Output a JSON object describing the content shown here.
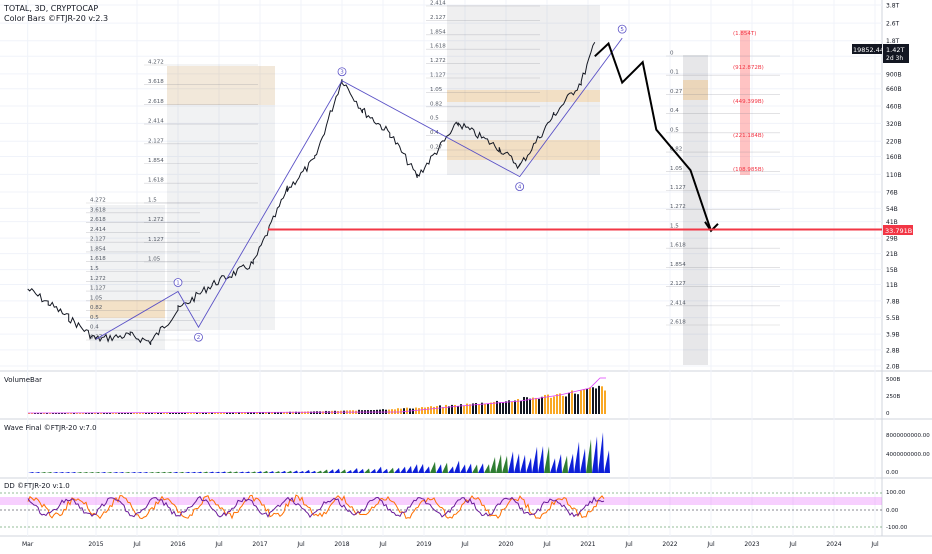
{
  "header": {
    "symbol_line": "TOTAL, 3D, CRYPTOCAP",
    "indicator_line": "Color Bars ©FTJR-20 v:2.3"
  },
  "price_badge": {
    "value": "19852.44%",
    "last_price": "1.42T",
    "countdown": "2d 3h"
  },
  "level_badge": "33.791B",
  "panes": {
    "volume_label": "VolumeBar",
    "wave_label": "Wave Final ©FTJR-20 v:7.0",
    "dd_label": "DD ©FTJR-20 v:1.0"
  },
  "colors": {
    "candles": "#131722",
    "wave": "#5b52c6",
    "red_line": "#f23645",
    "fib_orange": "#ff9800",
    "pink": "#e040fb",
    "forecast": "#000000"
  },
  "chart_data": [
    {
      "type": "line",
      "title": "TOTAL, 3D, CRYPTOCAP",
      "x_tick_labels": [
        "Mar",
        "2015",
        "Jul",
        "2016",
        "Jul",
        "2017",
        "Jul",
        "2018",
        "Jul",
        "2019",
        "Jul",
        "2020",
        "Jul",
        "2021",
        "Jul",
        "2022",
        "Jul",
        "2023",
        "Jul",
        "2024",
        "Jul"
      ],
      "y_scale": "log",
      "y_tick_labels": [
        "3.8T",
        "2.6T",
        "1.8T",
        "1.3T",
        "900B",
        "660B",
        "460B",
        "320B",
        "220B",
        "160B",
        "110B",
        "76B",
        "54B",
        "41B",
        "29B",
        "21B",
        "15B",
        "11B",
        "7.8B",
        "5.5B",
        "3.9B",
        "2.8B",
        "2.0B"
      ],
      "series": [
        {
          "values": [
            {
              "x": "2014-03",
              "y": 10
            },
            {
              "x": "2014-06",
              "y": 7.5
            },
            {
              "x": "2014-09",
              "y": 5.5
            },
            {
              "x": "2015-01",
              "y": 3.5
            },
            {
              "x": "2015-06",
              "y": 3.8
            },
            {
              "x": "2015-09",
              "y": 3.3
            },
            {
              "x": "2016-01",
              "y": 6.5
            },
            {
              "x": "2016-06",
              "y": 11
            },
            {
              "x": "2016-12",
              "y": 17
            },
            {
              "x": "2017-05",
              "y": 80
            },
            {
              "x": "2017-09",
              "y": 150
            },
            {
              "x": "2018-01",
              "y": 800
            },
            {
              "x": "2018-04",
              "y": 420
            },
            {
              "x": "2018-08",
              "y": 260
            },
            {
              "x": "2018-12",
              "y": 105
            },
            {
              "x": "2019-06",
              "y": 320
            },
            {
              "x": "2019-12",
              "y": 190
            },
            {
              "x": "2020-03",
              "y": 130
            },
            {
              "x": "2020-08",
              "y": 380
            },
            {
              "x": "2020-12",
              "y": 760
            },
            {
              "x": "2021-02",
              "y": 1700
            }
          ]
        }
      ],
      "wave_labels": [
        "1",
        "2",
        "3",
        "4",
        "5"
      ],
      "fib_levels_main": [
        "2.414",
        "2.127",
        "1.854",
        "1.618",
        "1.272",
        "1.127",
        "1.05",
        "0.82",
        "0.5",
        "0.4",
        "0.27"
      ],
      "fib_levels_mid": [
        "4.272",
        "3.618",
        "2.618",
        "2.414",
        "2.127",
        "1.854",
        "1.618",
        "1.5",
        "1.272",
        "1.127",
        "1.05"
      ],
      "fib_levels_left": [
        "4.272",
        "3.618",
        "2.618",
        "2.414",
        "2.127",
        "1.854",
        "1.618",
        "1.5",
        "1.272",
        "1.127",
        "1.05",
        "0.82",
        "0.5",
        "0.4",
        "0.27"
      ],
      "fib_levels_right": [
        "0",
        "0.1",
        "0.27",
        "0.4",
        "0.5",
        "0.82",
        "1.05",
        "1.127",
        "1.272",
        "1.5",
        "1.618",
        "1.854",
        "2.127",
        "2.414",
        "2.618"
      ],
      "target_labels": [
        "(1.854T)",
        "(912.872B)",
        "(449.399B)",
        "(221.184B)",
        "(108.985B)"
      ],
      "horizontal_level": "33.791B"
    },
    {
      "type": "bar",
      "title": "VolumeBar",
      "y_tick_labels": [
        "500B",
        "250B",
        "0"
      ]
    },
    {
      "type": "area",
      "title": "Wave Final ©FTJR-20 v:7.0",
      "y_tick_labels": [
        "8000000000.00",
        "4000000000.00",
        "0.00"
      ]
    },
    {
      "type": "line",
      "title": "DD ©FTJR-20 v:1.0",
      "y_tick_labels": [
        "100.00",
        "0.00",
        "-100.00"
      ]
    }
  ]
}
